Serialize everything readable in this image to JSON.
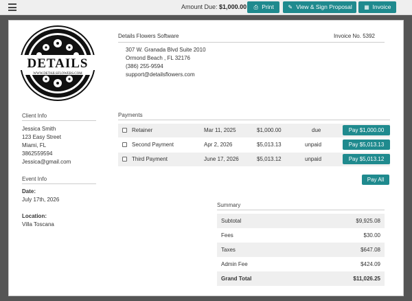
{
  "topbar": {
    "amount_label": "Amount Due:",
    "amount_value": "$1,000.00",
    "print_label": "Print",
    "sign_label": "View & Sign Proposal",
    "invoice_label": "Invoice"
  },
  "logo": {
    "wordmark": "DETAILS",
    "url_text": "WWW.DETAILSFLOWERS.COM"
  },
  "company": {
    "name": "Details Flowers Software",
    "invoice_no": "Invoice No. 5392",
    "address1": "307 W. Granada Blvd Suite 2010",
    "address2": "Ormond Beach , FL 32176",
    "phone": "(386) 255-9594",
    "email": "support@detailsflowers.com"
  },
  "client": {
    "heading": "Client Info",
    "name": "Jessica Smith",
    "street": "123 Easy Street",
    "city": "Miami, FL",
    "phone": "3862559594",
    "email": "Jessica@gmail.com"
  },
  "event": {
    "heading": "Event Info",
    "date_label": "Date:",
    "date_value": "July 17th, 2026",
    "location_label": "Location:",
    "location_value": "Villa Toscana"
  },
  "payments": {
    "heading": "Payments",
    "rows": [
      {
        "name": "Retainer",
        "date": "Mar 11, 2025",
        "amount": "$1,000.00",
        "status": "due",
        "button": "Pay $1,000.00"
      },
      {
        "name": "Second Payment",
        "date": "Apr 2, 2026",
        "amount": "$5,013.13",
        "status": "unpaid",
        "button": "Pay $5,013.13"
      },
      {
        "name": "Third Payment",
        "date": "June 17, 2026",
        "amount": "$5,013.12",
        "status": "unpaid",
        "button": "Pay $5,013.12"
      }
    ],
    "pay_all_label": "Pay All"
  },
  "summary": {
    "heading": "Summary",
    "rows": [
      {
        "label": "Subtotal",
        "value": "$9,925.08"
      },
      {
        "label": "Fees",
        "value": "$30.00"
      },
      {
        "label": "Taxes",
        "value": "$647.08"
      },
      {
        "label": "Admin Fee",
        "value": "$424.09"
      },
      {
        "label": "Grand Total",
        "value": "$11,026.25"
      }
    ]
  },
  "colors": {
    "accent": "#1f8a8e",
    "row_shade": "#efefef"
  },
  "icons": {
    "menu": "hamburger-icon",
    "print": "printer-icon",
    "sign": "pen-icon",
    "invoice": "document-icon"
  }
}
